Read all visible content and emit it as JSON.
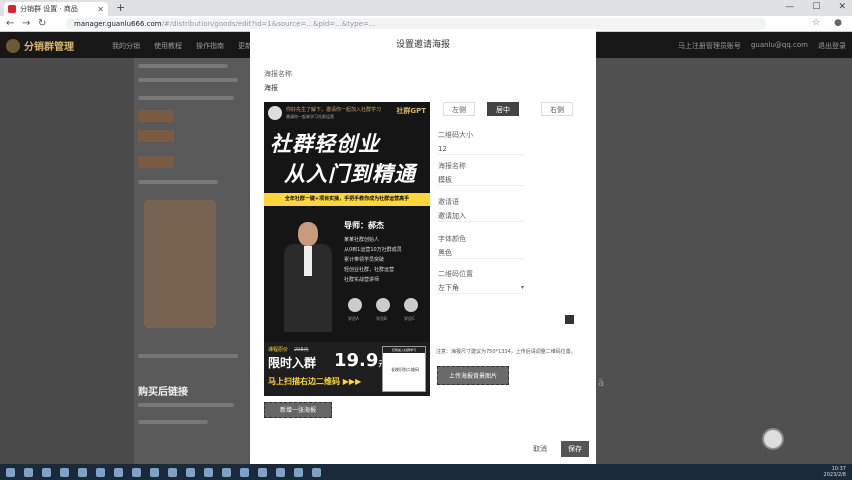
{
  "browser": {
    "tab_title": "分销群 设置 · 商品",
    "url_host": "manager.guanlu666.com",
    "url_rest": "/#/distribution/goods/edit?id=1&source=...&pid=...&type=..."
  },
  "site": {
    "logo": "分销群管理",
    "nav": [
      "我的分销",
      "使用教程",
      "操作指南",
      "更新日志"
    ],
    "header_right": [
      "马上注册管理员账号",
      "guanlu@qq.com",
      "退出登录"
    ],
    "bg_section_heading": "购买后链接"
  },
  "modal": {
    "title": "设置邀请海报",
    "name_label": "海报名称",
    "name_value": "海报",
    "layout_options": [
      "左侧",
      "居中",
      "右侧"
    ],
    "active_layout": 1,
    "fields": [
      {
        "label": "二维码大小",
        "value": "12"
      },
      {
        "label": "海报名称",
        "value": "模板"
      },
      {
        "label": "邀请语",
        "value": "邀请加入"
      },
      {
        "label": "字体颜色",
        "value": "黑色"
      },
      {
        "label": "二维码位置",
        "value": "左下角"
      }
    ],
    "note": "注意：海报尺寸建议为750*1334，上传后请调整二维码位置。",
    "upload_button": "上传海报背景图片",
    "add_button": "新增一张海报",
    "cancel": "取消",
    "confirm": "保存"
  },
  "poster": {
    "nickname": "你好先生了解下，邀请你一起加入社群学习",
    "tagline": "邀请你一起来学习社群运营",
    "brand": "社群GPT",
    "title_line1": "社群轻创业",
    "title_line2": "从入门到精通",
    "banner": "全年社群一键+项目实操，手把手教你成为社群运营高手",
    "mentor": "导师：郝杰",
    "bullets": [
      "某某社群创始人",
      "从0到1运营10万社群成员",
      "累计带领学员突破",
      "轻创业社群，社群运营",
      "社群实战营讲师"
    ],
    "students": [
      "学员A",
      "学员B",
      "学员C"
    ],
    "price_label": "课程原价",
    "price_original": "298元",
    "limit_text": "限时入群",
    "price": "19.9",
    "price_unit": "元",
    "cta": "马上扫描右边二维码 ▶▶▶",
    "qr_head": "扫码加入社群学习",
    "qr_text": "长按识别二维码"
  },
  "taskbar": {
    "time": "10:37",
    "date": "2023/2/8"
  }
}
